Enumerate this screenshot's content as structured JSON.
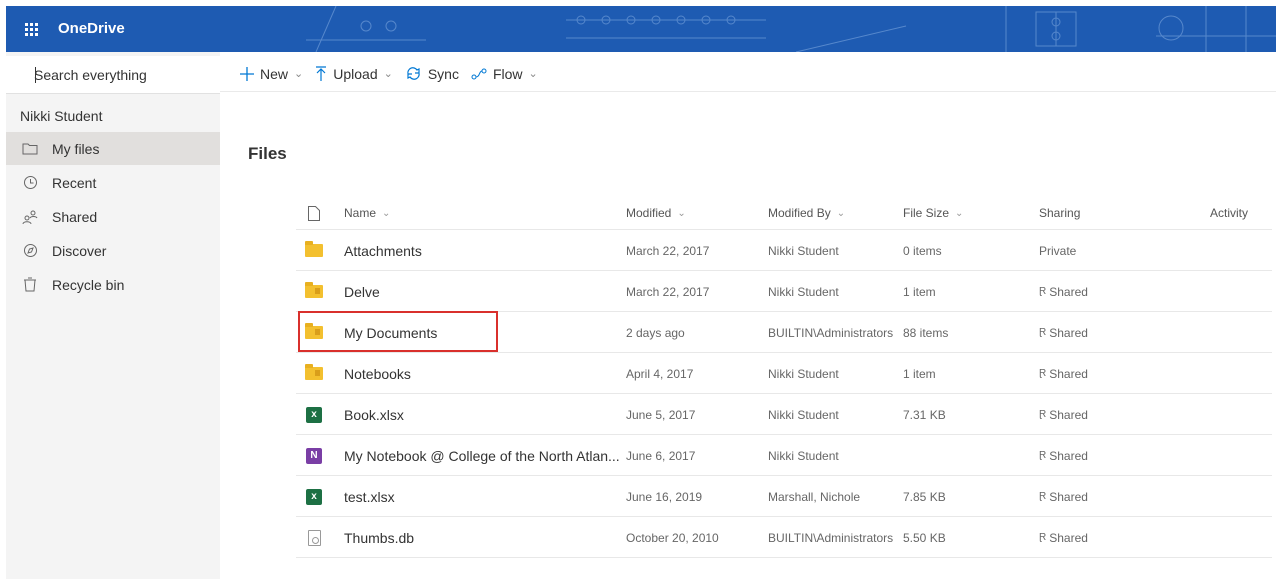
{
  "app": {
    "title": "OneDrive"
  },
  "search": {
    "placeholder": "Search everything"
  },
  "nav": {
    "user": "Nikki Student",
    "items": [
      {
        "label": "My files",
        "icon": "folder-icon",
        "active": true
      },
      {
        "label": "Recent",
        "icon": "clock-icon",
        "active": false
      },
      {
        "label": "Shared",
        "icon": "people-icon",
        "active": false
      },
      {
        "label": "Discover",
        "icon": "compass-icon",
        "active": false
      },
      {
        "label": "Recycle bin",
        "icon": "trash-icon",
        "active": false
      }
    ]
  },
  "commands": [
    {
      "label": "New",
      "icon": "plus-icon"
    },
    {
      "label": "Upload",
      "icon": "upload-icon"
    },
    {
      "label": "Sync",
      "icon": "sync-icon"
    },
    {
      "label": "Flow",
      "icon": "flow-icon"
    }
  ],
  "page": {
    "title": "Files"
  },
  "table": {
    "headers": {
      "name": "Name",
      "modified": "Modified",
      "modified_by": "Modified By",
      "file_size": "File Size",
      "sharing": "Sharing",
      "activity": "Activity"
    },
    "rows": [
      {
        "name": "Attachments",
        "type": "folder",
        "modified": "March 22, 2017",
        "modified_by": "Nikki Student",
        "size": "0 items",
        "sharing": "Private"
      },
      {
        "name": "Delve",
        "type": "folder-shared",
        "modified": "March 22, 2017",
        "modified_by": "Nikki Student",
        "size": "1 item",
        "sharing": "Shared"
      },
      {
        "name": "My Documents",
        "type": "folder-shared",
        "modified": "2 days ago",
        "modified_by": "BUILTIN\\Administrators",
        "size": "88 items",
        "sharing": "Shared"
      },
      {
        "name": "Notebooks",
        "type": "folder-shared",
        "modified": "April 4, 2017",
        "modified_by": "Nikki Student",
        "size": "1 item",
        "sharing": "Shared"
      },
      {
        "name": "Book.xlsx",
        "type": "excel",
        "modified": "June 5, 2017",
        "modified_by": "Nikki Student",
        "size": "7.31 KB",
        "sharing": "Shared"
      },
      {
        "name": "My Notebook @ College of the North Atlan...",
        "type": "onenote",
        "modified": "June 6, 2017",
        "modified_by": "Nikki Student",
        "size": "",
        "sharing": "Shared"
      },
      {
        "name": "test.xlsx",
        "type": "excel",
        "modified": "June 16, 2019",
        "modified_by": "Marshall, Nichole",
        "size": "7.85 KB",
        "sharing": "Shared"
      },
      {
        "name": "Thumbs.db",
        "type": "generic",
        "modified": "October 20, 2010",
        "modified_by": "BUILTIN\\Administrators",
        "size": "5.50 KB",
        "sharing": "Shared"
      }
    ]
  },
  "colors": {
    "header": "#1e5bb2",
    "accent": "#0078d4",
    "highlight": "#d9302c"
  }
}
